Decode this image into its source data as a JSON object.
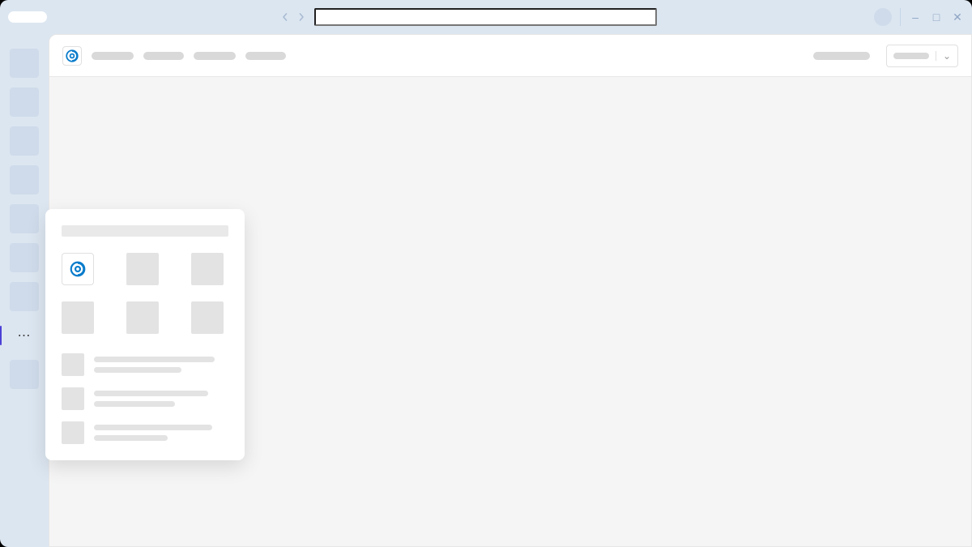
{
  "window": {
    "address_value": "",
    "controls": {
      "minimize": "–",
      "maximize": "□",
      "close": "✕"
    }
  },
  "rail": {
    "items": [
      "",
      "",
      "",
      "",
      "",
      "",
      "",
      ""
    ],
    "more_label": "⋯"
  },
  "topbar": {
    "nav_items": [
      "",
      "",
      "",
      ""
    ],
    "selector": {
      "label": "",
      "caret": "⌄"
    },
    "status": ""
  },
  "popover": {
    "search_placeholder": "",
    "tiles": [
      "app",
      "",
      "",
      "",
      "",
      ""
    ],
    "list": [
      {
        "line1": "",
        "line2": ""
      },
      {
        "line1": "",
        "line2": ""
      },
      {
        "line1": "",
        "line2": ""
      }
    ]
  },
  "icons": {
    "brand": "swirl-icon"
  },
  "colors": {
    "chrome": "#DCE6F1",
    "content_bg": "#F5F5F5",
    "brand_blue": "#0A7CCB",
    "accent": "#4B40D6"
  }
}
